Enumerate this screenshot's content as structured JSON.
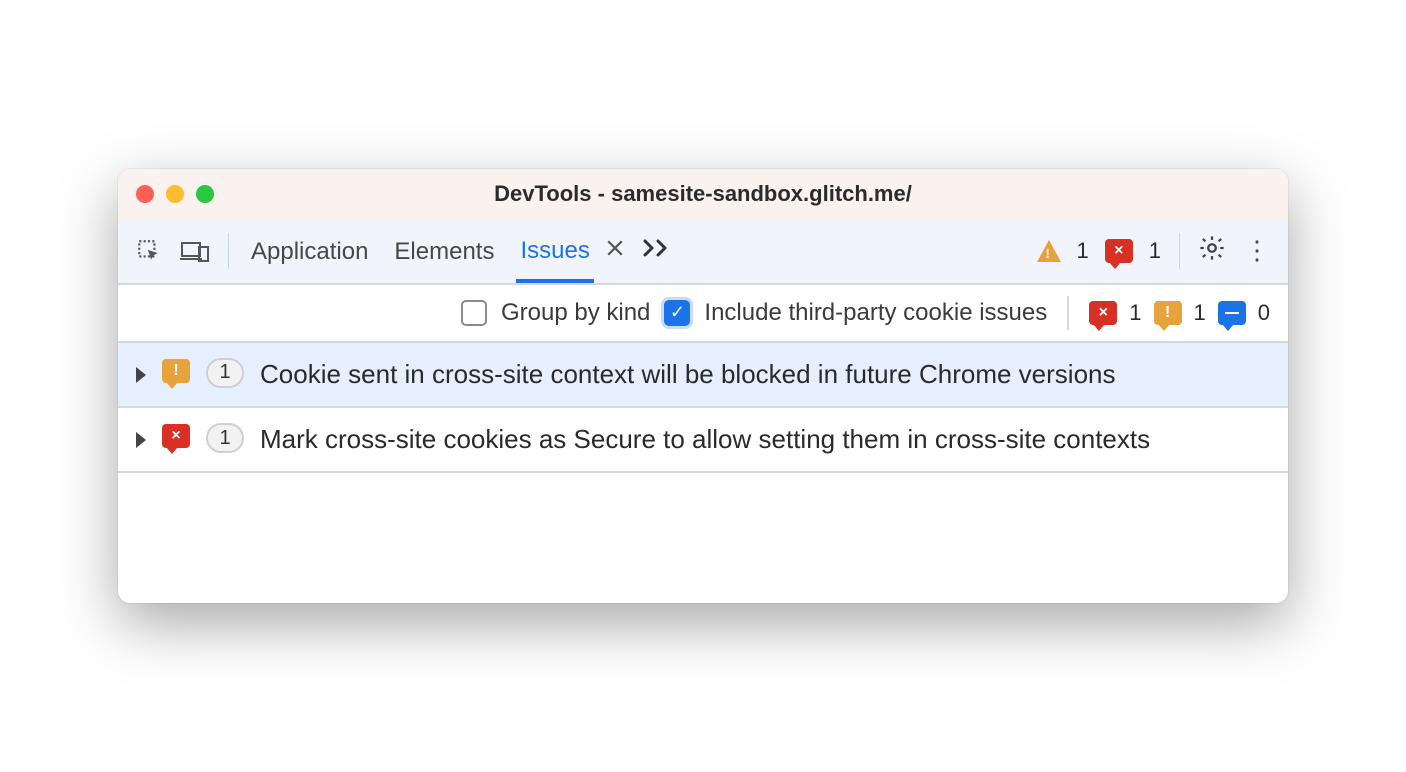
{
  "window": {
    "title": "DevTools - samesite-sandbox.glitch.me/"
  },
  "toolbar": {
    "tabs": [
      {
        "label": "Application"
      },
      {
        "label": "Elements"
      },
      {
        "label": "Issues",
        "active": true
      }
    ],
    "warning_count": "1",
    "error_count": "1"
  },
  "filterbar": {
    "group_by_kind_label": "Group by kind",
    "group_by_kind_checked": false,
    "include_third_party_label": "Include third-party cookie issues",
    "include_third_party_checked": true,
    "counts": {
      "error": "1",
      "warning": "1",
      "info": "0"
    }
  },
  "issues": [
    {
      "severity": "warning",
      "count": "1",
      "title": "Cookie sent in cross-site context will be blocked in future Chrome versions",
      "selected": true
    },
    {
      "severity": "error",
      "count": "1",
      "title": "Mark cross-site cookies as Secure to allow setting them in cross-site contexts",
      "selected": false
    }
  ]
}
